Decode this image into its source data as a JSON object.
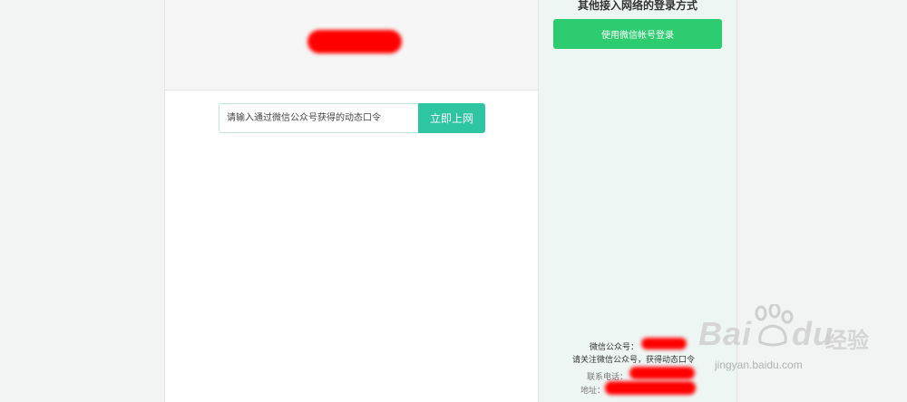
{
  "login": {
    "token_placeholder": "请输入通过微信公众号获得的动态口令",
    "submit_label": "立即上网"
  },
  "sidebar": {
    "title": "其他接入网络的登录方式",
    "wechat_button_label": "使用微信帐号登录",
    "footer": {
      "wechat_account_label": "微信公众号：",
      "follow_hint": "请关注微信公众号，获得动态口令",
      "phone_label": "联系电话：",
      "address_label": "地址："
    }
  },
  "watermark": {
    "brand": "Bai",
    "brand_suffix": "du",
    "product": "经验",
    "url": "jingyan.baidu.com"
  },
  "colors": {
    "accent": "#2ec5a3",
    "wechat_green": "#2ecc71",
    "redaction": "#ff0000"
  }
}
